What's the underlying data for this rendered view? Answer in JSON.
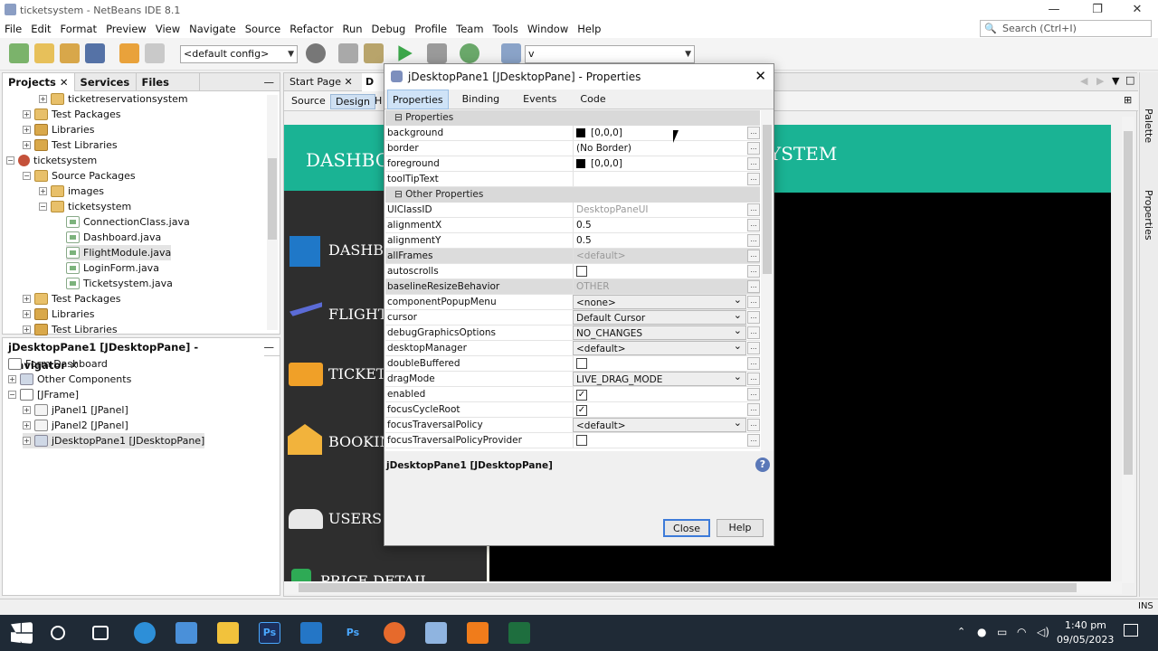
{
  "window": {
    "title": "ticketsystem - NetBeans IDE 8.1",
    "minimize": "—",
    "restore": "❐",
    "close": "✕"
  },
  "menu": [
    "File",
    "Edit",
    "Format",
    "Preview",
    "View",
    "Navigate",
    "Source",
    "Refactor",
    "Run",
    "Debug",
    "Profile",
    "Team",
    "Tools",
    "Window",
    "Help"
  ],
  "toolbar": {
    "config": "<default config>",
    "target": "v"
  },
  "search": {
    "placeholder": "Search (Ctrl+I)"
  },
  "project_panel": {
    "tabs": [
      "Projects",
      "Services",
      "Files"
    ],
    "tree": [
      {
        "label": "ticketreservationsystem"
      },
      {
        "label": "Test Packages"
      },
      {
        "label": "Libraries"
      },
      {
        "label": "Test Libraries"
      },
      {
        "label": "ticketsystem"
      },
      {
        "label": "Source Packages"
      },
      {
        "label": "images"
      },
      {
        "label": "ticketsystem"
      },
      {
        "label": "ConnectionClass.java"
      },
      {
        "label": "Dashboard.java"
      },
      {
        "label": "FlightModule.java"
      },
      {
        "label": "LoginForm.java"
      },
      {
        "label": "Ticketsystem.java"
      },
      {
        "label": "Test Packages"
      },
      {
        "label": "Libraries"
      },
      {
        "label": "Test Libraries"
      }
    ]
  },
  "navigator": {
    "title": "jDesktopPane1 [JDesktopPane] - Navigator",
    "tree": [
      {
        "label": "Form Dashboard"
      },
      {
        "label": "Other Components"
      },
      {
        "label": "[JFrame]"
      },
      {
        "label": "jPanel1 [JPanel]"
      },
      {
        "label": "jPanel2 [JPanel]"
      },
      {
        "label": "jDesktopPane1 [JDesktopPane]"
      }
    ]
  },
  "editor": {
    "tabs": [
      "Start Page",
      "D"
    ],
    "subtabs": [
      "Source",
      "Design",
      "H"
    ],
    "header_left": "DASHBO",
    "header_right": "YSTEM",
    "menu_items": [
      "DASHBO",
      "FLIGHT",
      "TICKET",
      "BOOKIN",
      "USERS",
      "PRICE DETAIL"
    ],
    "menu_colors": [
      "#1f78c8",
      "#5b6bd6",
      "#f0a028",
      "#f2b33c",
      "#e8e8e8",
      "#2eaa55"
    ]
  },
  "right_sidebar": {
    "palette": "Palette",
    "properties": "Properties"
  },
  "dialog": {
    "title": "jDesktopPane1 [JDesktopPane] - Properties",
    "tabs": [
      "Properties",
      "Binding",
      "Events",
      "Code"
    ],
    "categories": [
      "Properties",
      "Other Properties"
    ],
    "properties": [
      {
        "key": "background",
        "value": "[0,0,0]"
      },
      {
        "key": "border",
        "value": "(No Border)"
      },
      {
        "key": "foreground",
        "value": "[0,0,0]"
      },
      {
        "key": "toolTipText",
        "value": ""
      }
    ],
    "other": [
      {
        "key": "UIClassID",
        "value": "DesktopPaneUI"
      },
      {
        "key": "alignmentX",
        "value": "0.5"
      },
      {
        "key": "alignmentY",
        "value": "0.5"
      },
      {
        "key": "allFrames",
        "value": "<default>"
      },
      {
        "key": "autoscrolls",
        "value": ""
      },
      {
        "key": "baselineResizeBehavior",
        "value": "OTHER"
      },
      {
        "key": "componentPopupMenu",
        "value": "<none>"
      },
      {
        "key": "cursor",
        "value": "Default Cursor"
      },
      {
        "key": "debugGraphicsOptions",
        "value": "NO_CHANGES"
      },
      {
        "key": "desktopManager",
        "value": "<default>"
      },
      {
        "key": "doubleBuffered",
        "value": ""
      },
      {
        "key": "dragMode",
        "value": "LIVE_DRAG_MODE"
      },
      {
        "key": "enabled",
        "value": "✓"
      },
      {
        "key": "focusCycleRoot",
        "value": "✓"
      },
      {
        "key": "focusTraversalPolicy",
        "value": "<default>"
      },
      {
        "key": "focusTraversalPolicyProvider",
        "value": ""
      }
    ],
    "description": "jDesktopPane1 [JDesktopPane]",
    "close": "Close",
    "help": "Help"
  },
  "statusbar": {
    "mode": "INS"
  },
  "clock": {
    "time": "1:40 pm",
    "date": "09/05/2023"
  }
}
